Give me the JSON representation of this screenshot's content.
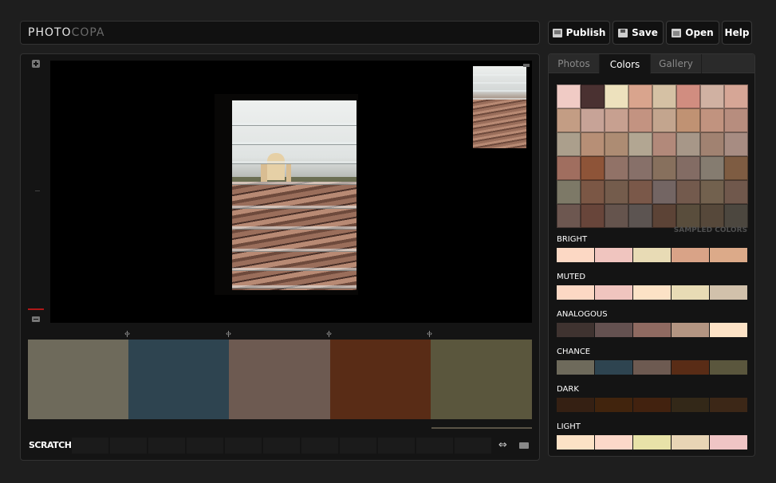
{
  "app": {
    "logo_part1": "PHOTO",
    "logo_part2": "COPA"
  },
  "toolbar": {
    "publish_label": "Publish",
    "save_label": "Save",
    "open_label": "Open",
    "help_label": "Help"
  },
  "tabs": [
    {
      "label": "Photos",
      "active": false
    },
    {
      "label": "Colors",
      "active": true
    },
    {
      "label": "Gallery",
      "active": false
    }
  ],
  "editor": {
    "handle_glyph": "‹|›",
    "main_swatches": [
      "#6e6a5b",
      "#2e4450",
      "#6d5a51",
      "#592c16",
      "#5a563d"
    ],
    "scratch_label": "SCRATCH",
    "scratch_slot_count": 11,
    "swap_glyph": "⇔"
  },
  "sampled_grid": [
    "#f0cbc5",
    "#4a3131",
    "#ede1bd",
    "#d9a48d",
    "#d5c1a4",
    "#d18d80",
    "#d0b1a2",
    "#d6a696",
    "#c39d84",
    "#c7a397",
    "#c7a090",
    "#c39381",
    "#c3a58e",
    "#c09273",
    "#c1937f",
    "#b78d7e",
    "#ab9f8c",
    "#b78f76",
    "#ad8c73",
    "#b2a692",
    "#b2897a",
    "#a79788",
    "#a18271",
    "#a78c82",
    "#a06e5f",
    "#8e5438",
    "#917267",
    "#877069",
    "#87705d",
    "#836c64",
    "#857c70",
    "#7e5c42",
    "#7d7967",
    "#7b5745",
    "#745c4c",
    "#7a5849",
    "#736563",
    "#735a4d",
    "#72614e",
    "#70584c",
    "#6d5750",
    "#68453a",
    "#65544d",
    "#5c5451",
    "#5c4336",
    "#594d3c",
    "#56483a",
    "#4c473f"
  ],
  "sampled_label": "SAMPLED COLORS",
  "palettes": [
    {
      "label": "BRIGHT",
      "colors": [
        "#fcd8c4",
        "#f0c5bf",
        "#e8dbb5",
        "#d9a387",
        "#dcaa89"
      ]
    },
    {
      "label": "MUTED",
      "colors": [
        "#fcd8c4",
        "#f0c5bf",
        "#fce2c6",
        "#e8dbb5",
        "#d1c1ab"
      ]
    },
    {
      "label": "ANALOGOUS",
      "colors": [
        "#3f3330",
        "#645150",
        "#8f6a61",
        "#b39582",
        "#fce2c6"
      ]
    },
    {
      "label": "CHANCE",
      "colors": [
        "#6e6a5b",
        "#2e4450",
        "#6d5a51",
        "#592c16",
        "#5a563d"
      ]
    },
    {
      "label": "DARK",
      "colors": [
        "#352013",
        "#41240d",
        "#42220f",
        "#332818",
        "#3c2717"
      ]
    },
    {
      "label": "LIGHT",
      "colors": [
        "#fce2c6",
        "#fcd8c9",
        "#e8e2a8",
        "#e8d5b5",
        "#f0c5c5"
      ]
    }
  ]
}
